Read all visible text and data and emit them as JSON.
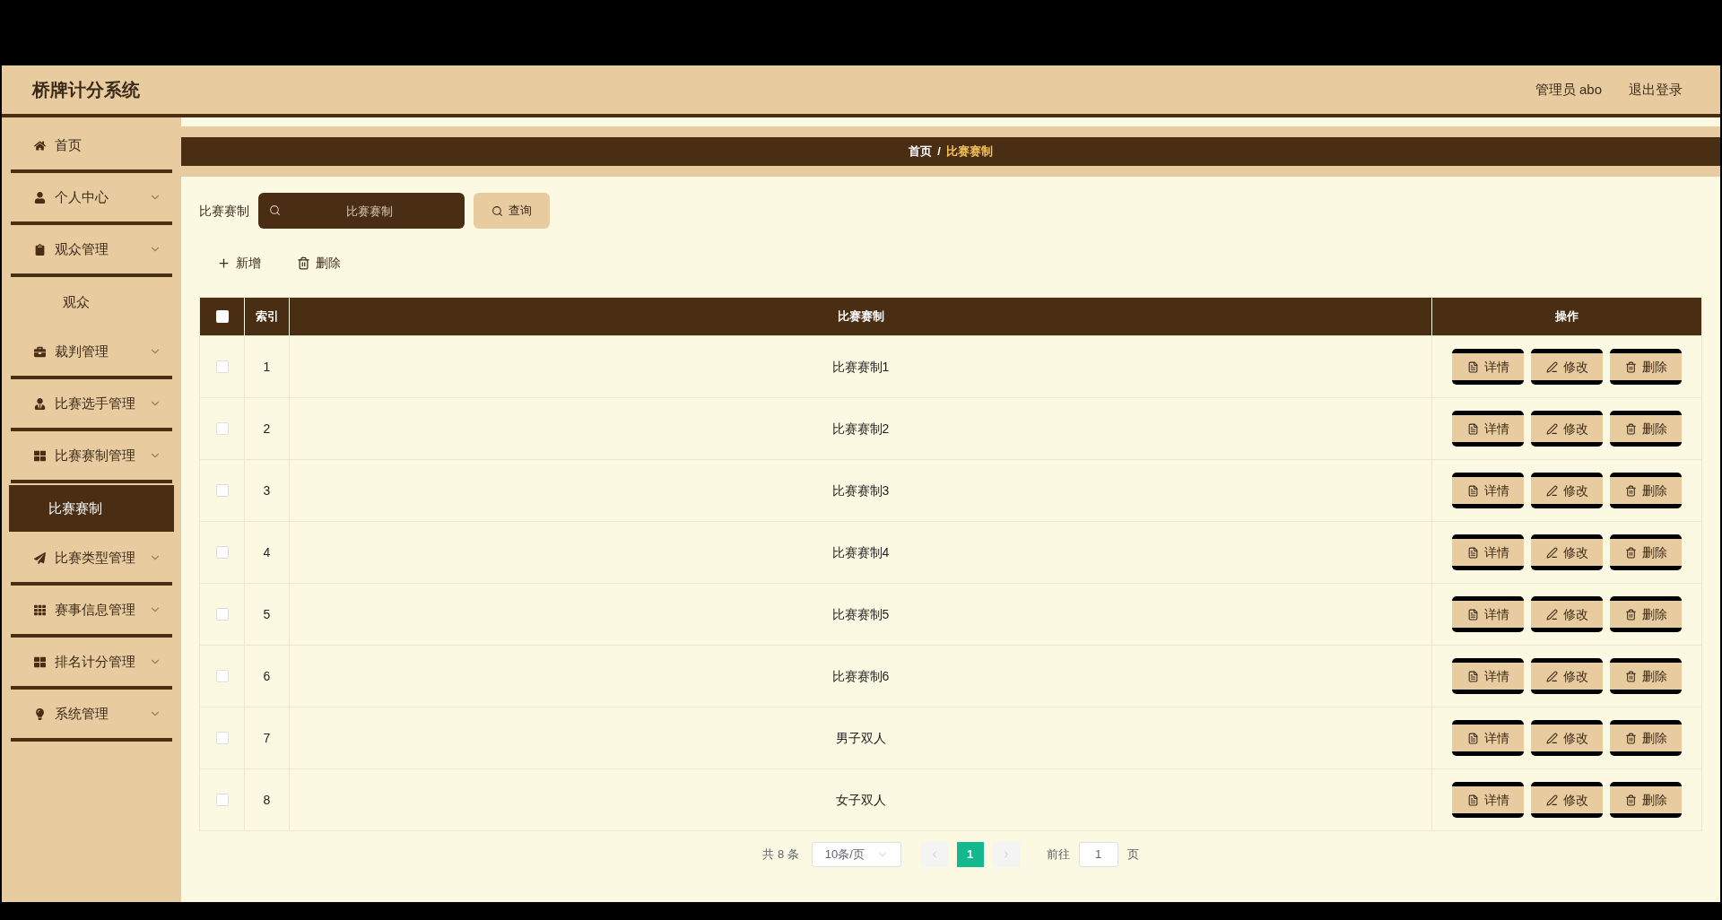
{
  "header": {
    "title": "桥牌计分系统",
    "user": "管理员 abo",
    "logout": "退出登录"
  },
  "sidebar": {
    "items": [
      {
        "label": "首页",
        "kind": "link",
        "selected": false
      },
      {
        "label": "个人中心",
        "kind": "menu",
        "selected": false
      },
      {
        "label": "观众管理",
        "kind": "menu",
        "selected": false,
        "children": [
          {
            "label": "观众",
            "selected": false
          }
        ]
      },
      {
        "label": "裁判管理",
        "kind": "menu",
        "selected": false
      },
      {
        "label": "比赛选手管理",
        "kind": "menu",
        "selected": false
      },
      {
        "label": "比赛赛制管理",
        "kind": "menu",
        "selected": false,
        "children": [
          {
            "label": "比赛赛制",
            "selected": true
          }
        ]
      },
      {
        "label": "比赛类型管理",
        "kind": "menu",
        "selected": false
      },
      {
        "label": "赛事信息管理",
        "kind": "menu",
        "selected": false
      },
      {
        "label": "排名计分管理",
        "kind": "menu",
        "selected": false
      },
      {
        "label": "系统管理",
        "kind": "menu",
        "selected": false
      }
    ]
  },
  "breadcrumb": [
    {
      "label": "首页",
      "selected": false
    },
    {
      "label": "/",
      "selected": false
    },
    {
      "label": "比赛赛制",
      "selected": true
    }
  ],
  "search": {
    "label": "比赛赛制",
    "placeholder": "比赛赛制",
    "button": "查询"
  },
  "toolbar": [
    "新增",
    "删除"
  ],
  "table": {
    "columns": [
      "索引",
      "比赛赛制",
      "操作"
    ],
    "header_checked": false,
    "rows": [
      {
        "index": "1",
        "name": "比赛赛制1",
        "checked": false,
        "actions": [
          "详情",
          "修改",
          "删除"
        ]
      },
      {
        "index": "2",
        "name": "比赛赛制2",
        "checked": false,
        "actions": [
          "详情",
          "修改",
          "删除"
        ]
      },
      {
        "index": "3",
        "name": "比赛赛制3",
        "checked": false,
        "actions": [
          "详情",
          "修改",
          "删除"
        ]
      },
      {
        "index": "4",
        "name": "比赛赛制4",
        "checked": false,
        "actions": [
          "详情",
          "修改",
          "删除"
        ]
      },
      {
        "index": "5",
        "name": "比赛赛制5",
        "checked": false,
        "actions": [
          "详情",
          "修改",
          "删除"
        ]
      },
      {
        "index": "6",
        "name": "比赛赛制6",
        "checked": false,
        "actions": [
          "详情",
          "修改",
          "删除"
        ]
      },
      {
        "index": "7",
        "name": "男子双人",
        "checked": false,
        "actions": [
          "详情",
          "修改",
          "删除"
        ]
      },
      {
        "index": "8",
        "name": "女子双人",
        "checked": false,
        "actions": [
          "详情",
          "修改",
          "删除"
        ]
      }
    ]
  },
  "pagination": {
    "total": "共 8 条",
    "page_size": "10条/页",
    "pages": [
      {
        "label": "1",
        "selected": true
      }
    ],
    "goto_label": "前往",
    "goto_value": "1",
    "goto_suffix": "页"
  }
}
